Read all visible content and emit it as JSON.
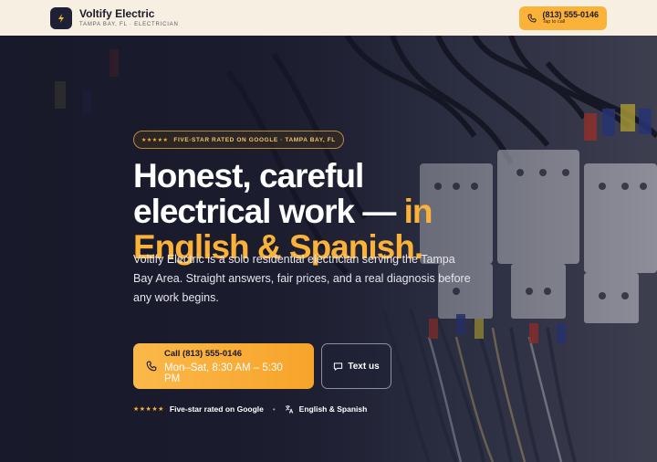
{
  "brand": {
    "name": "Voltify Electric",
    "subtitle": "TAMPA BAY, FL · ELECTRICIAN",
    "logo_icon": "lightning-bolt-icon"
  },
  "header_call": {
    "number": "(813) 555-0146",
    "sub": "Tap to call",
    "icon": "phone-icon"
  },
  "hero": {
    "badge_stars": "★★★★★",
    "badge_text": "FIVE-STAR RATED ON GOOGLE · TAMPA BAY, FL",
    "headline_line1": "Honest, careful",
    "headline_line2": "electrical work —",
    "headline_accent1": "in",
    "headline_accent2": "English & Spanish.",
    "lede": "Voltify Electric is a solo residential electrician serving the Tampa Bay Area. Straight answers, fair prices, and a real diagnosis before any work begins.",
    "call_button": {
      "number": "Call (813) 555-0146",
      "hours": "Mon–Sat, 8:30 AM – 5:30 PM",
      "icon": "phone-icon"
    },
    "text_button": {
      "label": "Text us",
      "icon": "message-icon"
    },
    "trust": {
      "stars": "★★★★★",
      "rating_label": "Five-star rated on Google",
      "separator": "•",
      "language_label": "English & Spanish",
      "language_icon": "translate-icon"
    }
  },
  "colors": {
    "accent": "#fbb239",
    "header_bg": "#f6efe2",
    "hero_bg": "#1b1c2e",
    "text_light": "#ffffff"
  }
}
